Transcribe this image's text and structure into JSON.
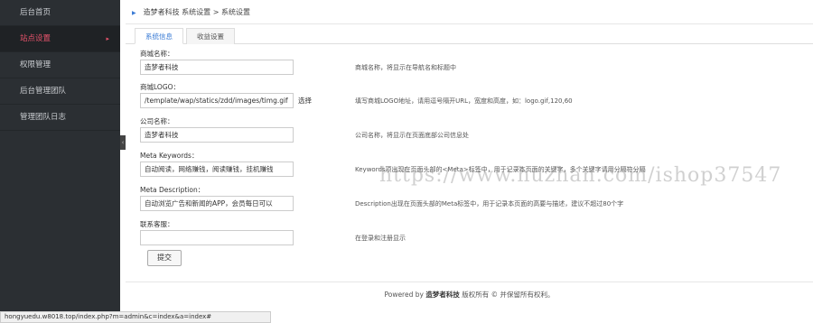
{
  "sidebar": {
    "items": [
      {
        "label": "后台首页"
      },
      {
        "label": "站点设置",
        "caret": "▸"
      },
      {
        "label": "权限管理"
      },
      {
        "label": "后台管理团队"
      },
      {
        "label": "管理团队日志"
      }
    ],
    "toggle": "‹"
  },
  "breadcrumb": {
    "text": "造梦者科技 系统设置 > 系统设置",
    "arrow": "▶"
  },
  "tabs": [
    {
      "label": "系统信息"
    },
    {
      "label": "收益设置"
    }
  ],
  "form": {
    "shop_name": {
      "label": "商城名称：",
      "value": "造梦者科技",
      "hint": "商城名称，将显示在导航名和标题中"
    },
    "shop_logo": {
      "label": "商城LOGO：",
      "value": "/template/wap/statics/zdd/images/timg.gif",
      "extra": "选择",
      "hint": "填写商城LOGO地址，请用逗号隔开URL，宽度和高度，如：logo.gif,120,60"
    },
    "company": {
      "label": "公司名称：",
      "value": "造梦者科技",
      "hint": "公司名称，将显示在页面底部公司信息处"
    },
    "keywords": {
      "label": "Meta Keywords：",
      "value": "自动阅读，网络赚钱，阅读赚钱，挂机赚钱",
      "hint": "Keywords项出现在页面头部的<Meta>标签中，用于记录本页面的关键字，多个关键字请用分隔符分隔"
    },
    "description": {
      "label": "Meta Description：",
      "value": "自动浏览广告和新闻的APP，会员每日可以",
      "hint": "Description出现在页面头部的Meta标签中，用于记录本页面的高要与描述，建议不超过80个字"
    },
    "service": {
      "label": "联系客服：",
      "value": "",
      "hint": "在登录和注册显示"
    },
    "submit_label": "提交"
  },
  "footer": {
    "prefix": "Powered by",
    "brand": "造梦者科技",
    "suffix": "版权所有 © 并保留所有权利。"
  },
  "watermark": "https://www.huzhan.com/ishop37547",
  "statusbar": "hongyuedu.w8018.top/index.php?m=admin&c=index&a=index#",
  "colors": {
    "sidebar_bg": "#2b2f33",
    "accent": "#e6536b",
    "link": "#3a7bd5"
  }
}
